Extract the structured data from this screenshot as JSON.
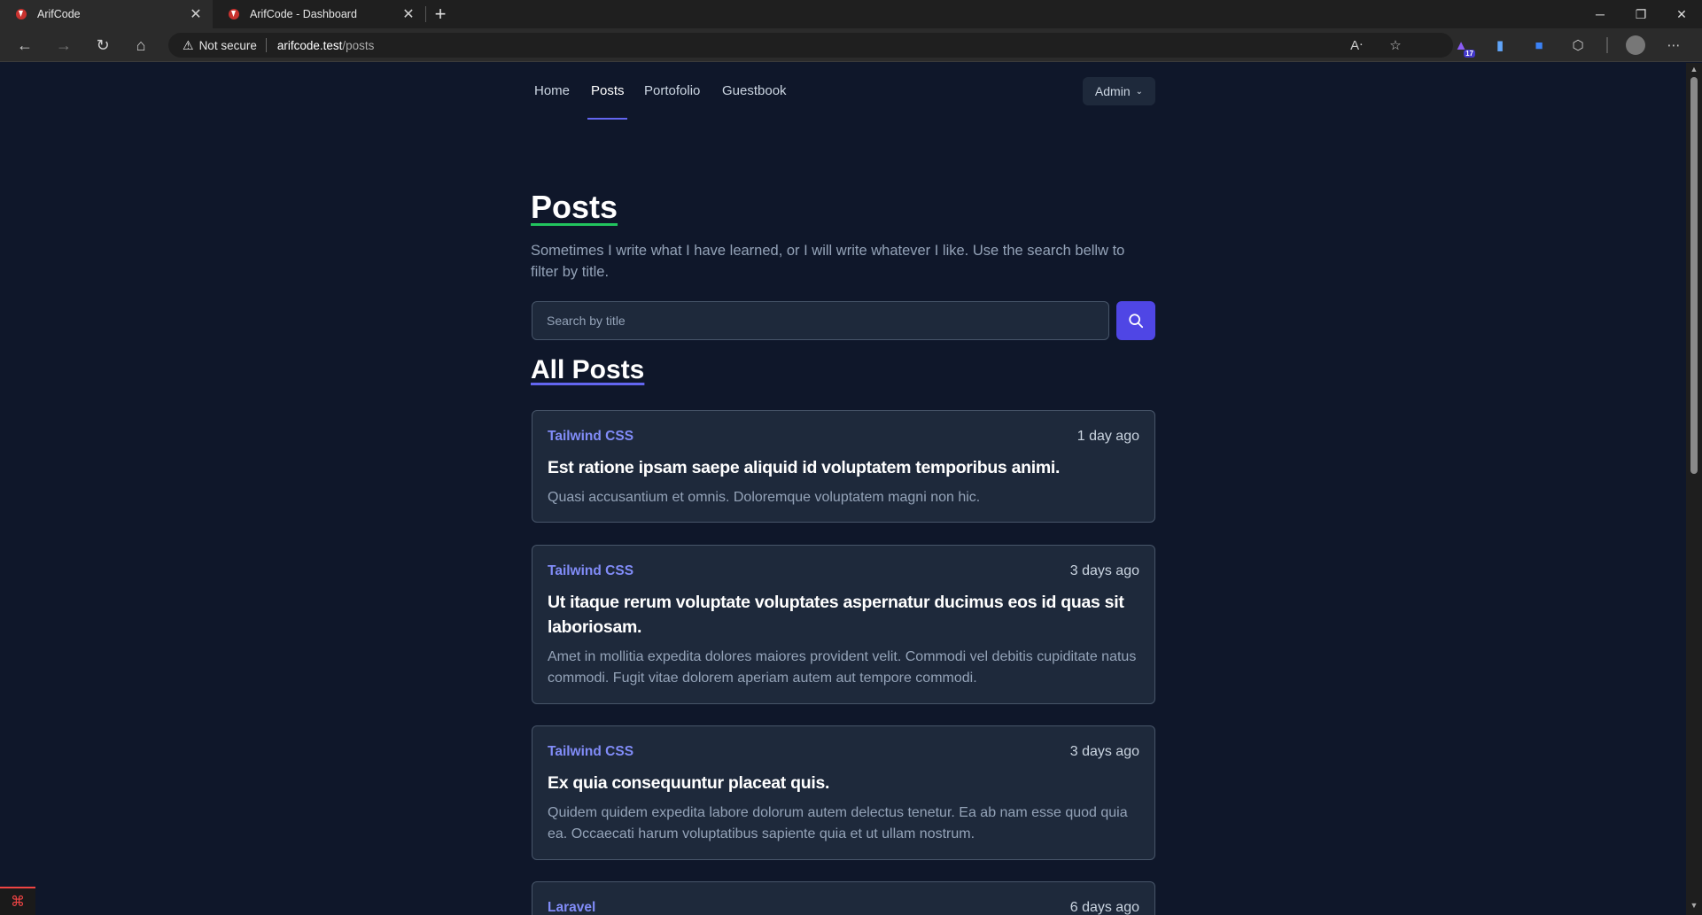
{
  "browser": {
    "tabs": [
      {
        "title": "ArifCode",
        "active": true
      },
      {
        "title": "ArifCode - Dashboard",
        "active": false
      }
    ],
    "security_label": "Not secure",
    "url_host": "arifcode.test",
    "url_path": "/posts",
    "extension_badge": "17"
  },
  "nav": {
    "links": [
      "Home",
      "Posts",
      "Portofolio",
      "Guestbook"
    ],
    "active": "Posts",
    "admin_label": "Admin"
  },
  "page": {
    "title": "Posts",
    "intro": "Sometimes I write what I have learned, or I will write whatever I like. Use the search bellw to filter by title.",
    "search_placeholder": "Search by title",
    "section_title": "All Posts"
  },
  "posts": [
    {
      "category": "Tailwind CSS",
      "time": "1 day ago",
      "title": "Est ratione ipsam saepe aliquid id voluptatem temporibus animi.",
      "excerpt": "Quasi accusantium et omnis. Doloremque voluptatem magni non hic."
    },
    {
      "category": "Tailwind CSS",
      "time": "3 days ago",
      "title": "Ut itaque rerum voluptate voluptates aspernatur ducimus eos id quas sit laboriosam.",
      "excerpt": "Amet in mollitia expedita dolores maiores provident velit. Commodi vel debitis cupiditate natus commodi. Fugit vitae dolorem aperiam autem aut tempore commodi."
    },
    {
      "category": "Tailwind CSS",
      "time": "3 days ago",
      "title": "Ex quia consequuntur placeat quis.",
      "excerpt": "Quidem quidem expedita labore dolorum autem delectus tenetur. Ea ab nam esse quod quia ea. Occaecati harum voluptatibus sapiente quia et ut ullam nostrum."
    },
    {
      "category": "Laravel",
      "time": "6 days ago",
      "title": "",
      "excerpt": ""
    }
  ],
  "colors": {
    "background": "#0f172a",
    "card": "#1e293b",
    "accent": "#4f46e5",
    "category": "#818cf8",
    "title_underline": "#22c55e"
  }
}
